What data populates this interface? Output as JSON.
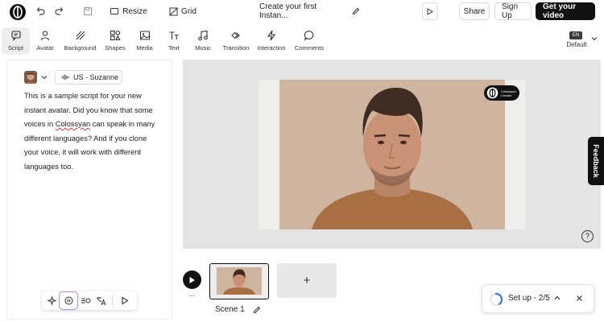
{
  "header": {
    "resize_label": "Resize",
    "grid_label": "Grid",
    "title": "Create your first Instan...",
    "share_label": "Share",
    "signup_label": "Sign Up",
    "get_video_label": "Get your video"
  },
  "toolbar": {
    "items": [
      {
        "label": "Script",
        "icon": "script-icon"
      },
      {
        "label": "Avatar",
        "icon": "avatar-icon"
      },
      {
        "label": "Background",
        "icon": "background-icon"
      },
      {
        "label": "Shapes",
        "icon": "shapes-icon"
      },
      {
        "label": "Media",
        "icon": "media-icon"
      },
      {
        "label": "Text",
        "icon": "text-icon"
      },
      {
        "label": "Music",
        "icon": "music-icon"
      },
      {
        "label": "Transition",
        "icon": "transition-icon"
      },
      {
        "label": "Interaction",
        "icon": "interaction-icon"
      },
      {
        "label": "Comments",
        "icon": "comments-icon"
      }
    ],
    "language_badge": "EN",
    "language_label": "Default"
  },
  "script_panel": {
    "voice_label": "US - Suzanne",
    "text_before": "This is a sample script for your new instant avatar. Did you know that some voices in ",
    "text_flagged": "Colossyan",
    "text_after": " can speak in many different languages? And if you clone your voice, it will work with different languages too."
  },
  "canvas": {
    "logo_text": "Colossyan Creator",
    "feedback_label": "Feedback",
    "help_icon": "?"
  },
  "timeline": {
    "scene_label": "Scene 1",
    "more_label": "...",
    "add_label": "+"
  },
  "setup_widget": {
    "label": "Set up - 2/5",
    "progress_fraction": 0.4
  },
  "colors": {
    "accent": "#7b61ff",
    "dark": "#111111",
    "canvas_bg": "#e4e4e4"
  }
}
